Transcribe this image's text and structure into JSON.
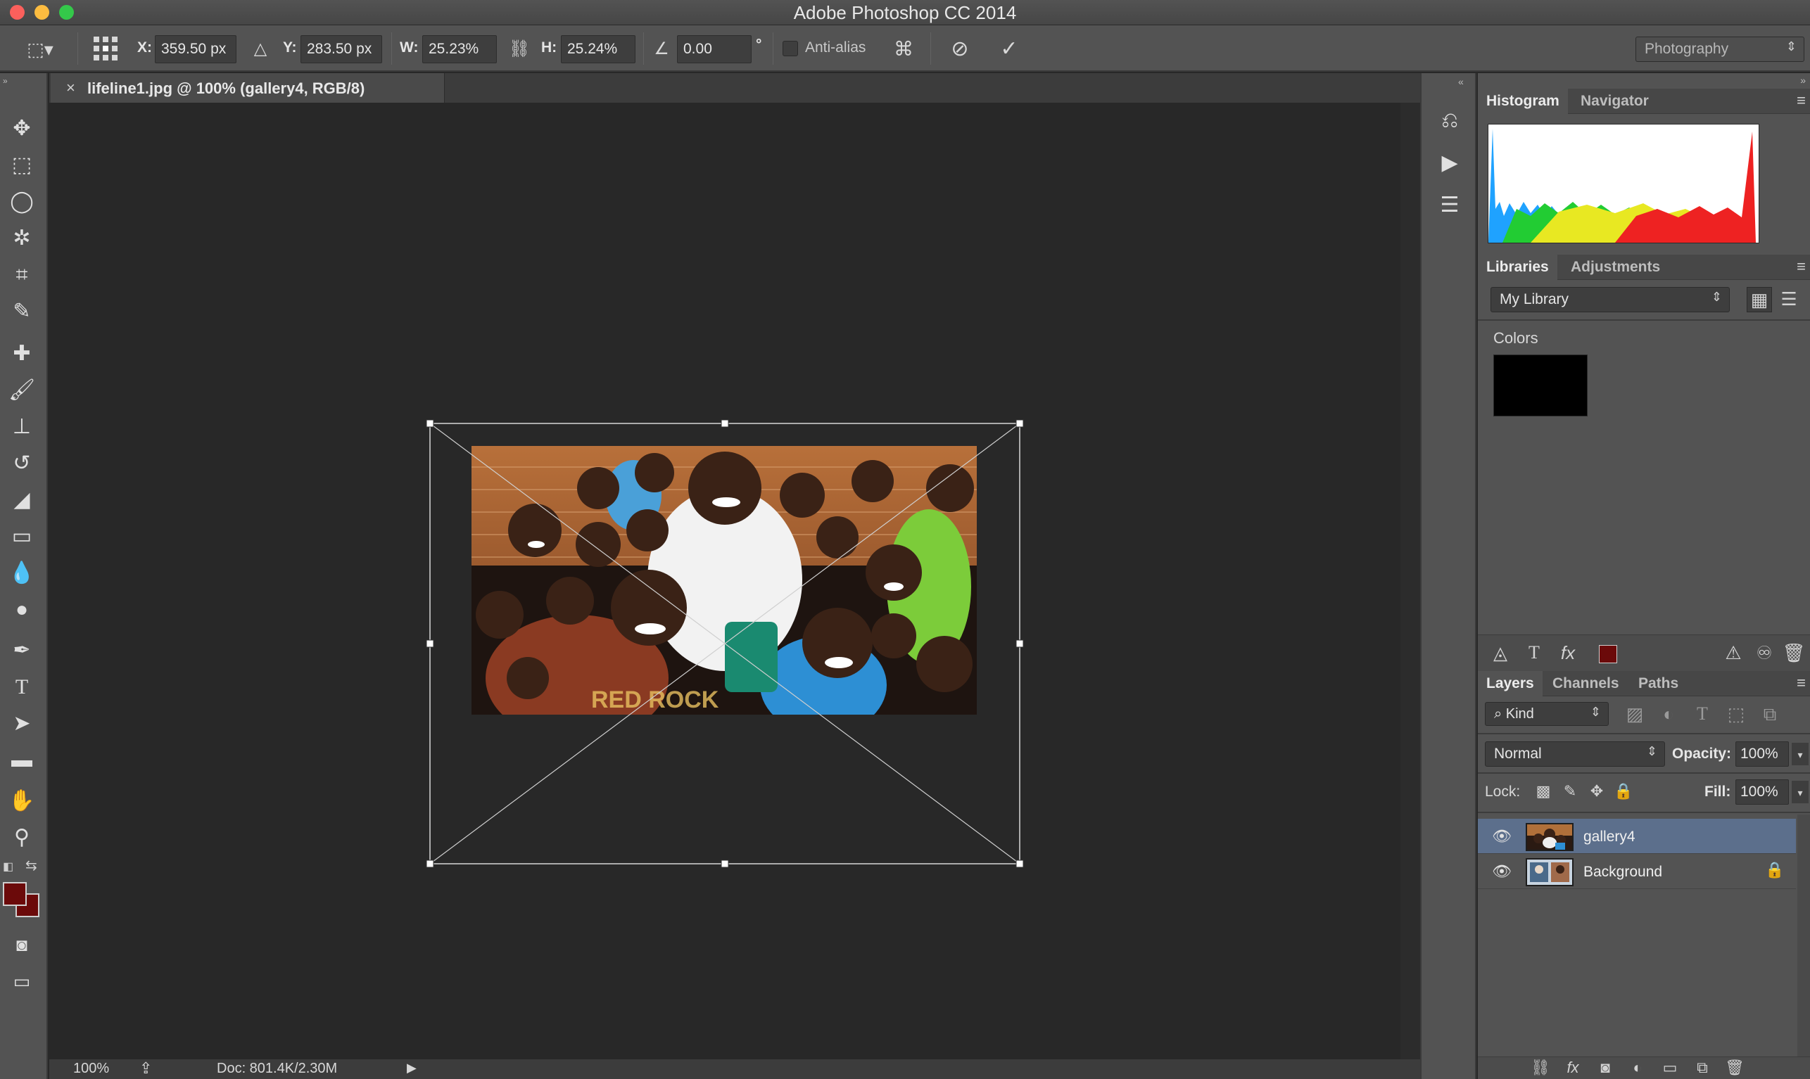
{
  "window": {
    "title": "Adobe Photoshop CC 2014",
    "colors": {
      "close": "#fc605c",
      "minimize": "#fdbc40",
      "zoom": "#34c84a"
    }
  },
  "options_bar": {
    "x_label": "X:",
    "x_value": "359.50 px",
    "y_label": "Y:",
    "y_value": "283.50 px",
    "w_label": "W:",
    "w_value": "25.23%",
    "h_label": "H:",
    "h_value": "25.24%",
    "angle_value": "0.00",
    "degree_symbol": "°",
    "antialias_label": "Anti-alias",
    "workspace": "Photography"
  },
  "document": {
    "tab_title": "lifeline1.jpg @ 100% (gallery4, RGB/8)",
    "close_symbol": "×"
  },
  "status_bar": {
    "zoom": "100%",
    "doc_info": "Doc: 801.4K/2.30M"
  },
  "panels": {
    "histogram_tabs": [
      "Histogram",
      "Navigator"
    ],
    "libraries_tabs": [
      "Libraries",
      "Adjustments"
    ],
    "library_select": "My Library",
    "colors_heading": "Colors",
    "swatch_color": "#000000",
    "layers_tabs": [
      "Layers",
      "Channels",
      "Paths"
    ],
    "kind_filter": "Kind",
    "blend_mode": "Normal",
    "opacity_label": "Opacity:",
    "opacity_value": "100%",
    "lock_label": "Lock:",
    "fill_label": "Fill:",
    "fill_value": "100%",
    "layers": [
      {
        "name": "gallery4",
        "selected": true,
        "locked": false
      },
      {
        "name": "Background",
        "selected": false,
        "locked": true
      }
    ]
  },
  "tools": {
    "foreground_color": "#6b0a0a",
    "background_color": "#6b0a0a"
  }
}
